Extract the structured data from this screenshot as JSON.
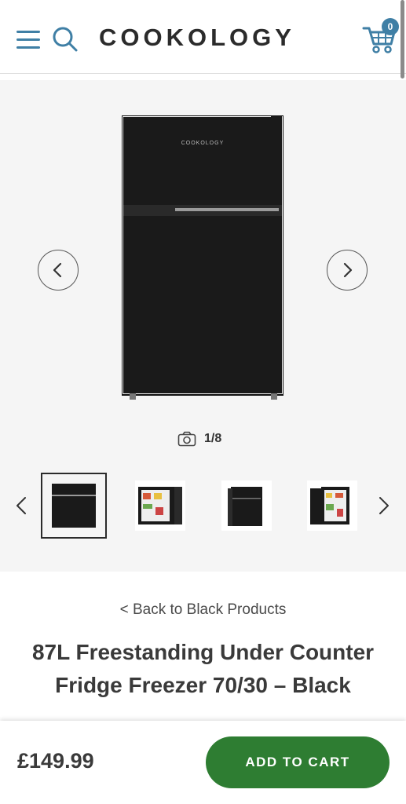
{
  "header": {
    "logo_text": "COOKOLOGY",
    "cart_count": "0",
    "icons": {
      "menu": "hamburger-menu-icon",
      "search": "search-icon",
      "cart": "shopping-cart-icon"
    },
    "accent_color": "#3f7fa5"
  },
  "gallery": {
    "fridge_brand": "COOKOLOGY",
    "image_counter": "1/8",
    "thumbnails": [
      {
        "label": "front-closed",
        "active": true
      },
      {
        "label": "doors-open",
        "active": false
      },
      {
        "label": "angled-closed",
        "active": false
      },
      {
        "label": "angled-open",
        "active": false
      }
    ]
  },
  "product": {
    "back_link": "< Back to Black Products",
    "title": "87L Freestanding Under Counter Fridge Freezer 70/30 – Black"
  },
  "buy_bar": {
    "price": "£149.99",
    "add_to_cart_label": "ADD TO CART",
    "button_color": "#2e7d32"
  }
}
